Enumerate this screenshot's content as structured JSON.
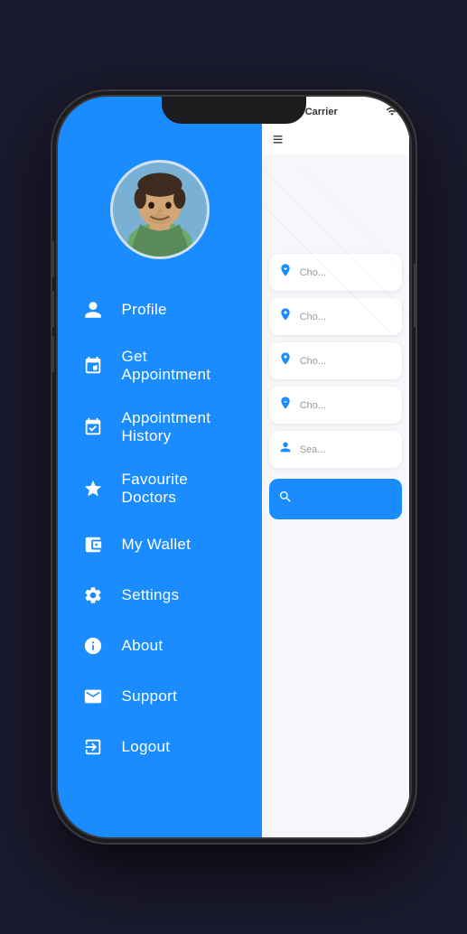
{
  "phone": {
    "notch": true
  },
  "statusBar": {
    "dots": [
      "filled",
      "filled",
      "empty",
      "empty"
    ],
    "carrier": "Carrier",
    "wifi": "⇡"
  },
  "menu": {
    "items": [
      {
        "id": "profile",
        "label": "Profile",
        "icon": "person"
      },
      {
        "id": "get-appointment",
        "label": "Get Appointment",
        "icon": "calendar-plus"
      },
      {
        "id": "appointment-history",
        "label": "Appointment History",
        "icon": "calendar-check"
      },
      {
        "id": "favourite-doctors",
        "label": "Favourite Doctors",
        "icon": "star"
      },
      {
        "id": "my-wallet",
        "label": "My Wallet",
        "icon": "wallet"
      },
      {
        "id": "settings",
        "label": "Settings",
        "icon": "gear"
      },
      {
        "id": "about",
        "label": "About",
        "icon": "info"
      },
      {
        "id": "support",
        "label": "Support",
        "icon": "envelope"
      },
      {
        "id": "logout",
        "label": "Logout",
        "icon": "logout"
      }
    ]
  },
  "content": {
    "hamburger": "≡",
    "searchItems": [
      {
        "id": "item1",
        "text": "Cho...",
        "iconType": "location-person"
      },
      {
        "id": "item2",
        "text": "Cho...",
        "iconType": "location"
      },
      {
        "id": "item3",
        "text": "Cho...",
        "iconType": "location"
      },
      {
        "id": "item4",
        "text": "Cho...",
        "iconType": "location-person"
      },
      {
        "id": "item5",
        "text": "Sea...",
        "iconType": "person-search"
      }
    ],
    "searchButtonText": ""
  }
}
